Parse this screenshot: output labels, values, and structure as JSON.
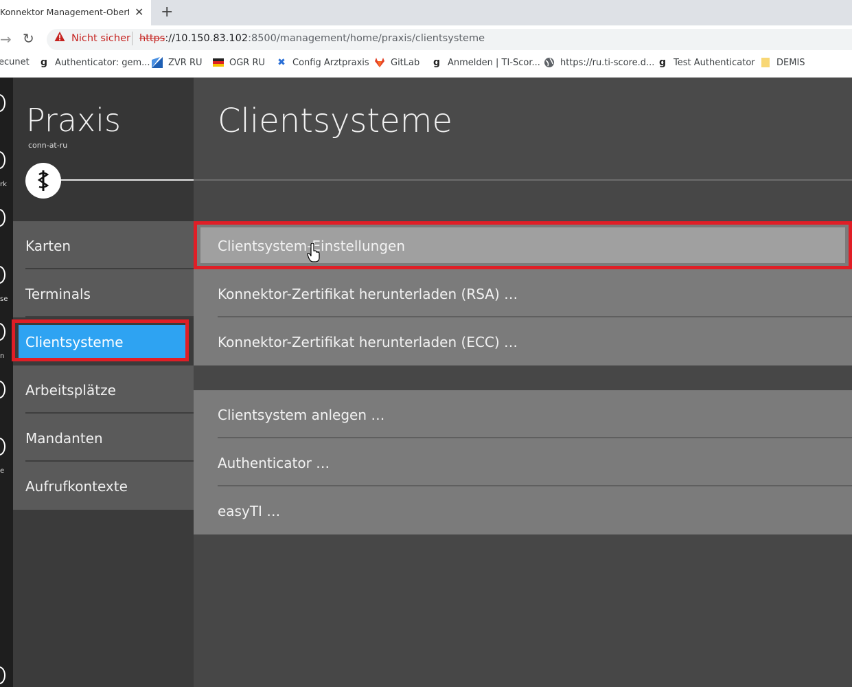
{
  "browser": {
    "tab_title": "Konnektor Management-Oberfläche",
    "tab_close": "✕",
    "new_tab": "+",
    "security_label": "Nicht sicher",
    "url_scheme": "https",
    "url_host": "://10.150.83.102",
    "url_path": ":8500/management/home/praxis/clientsysteme",
    "bookmarks": [
      {
        "label": "ecunet",
        "icon": "none"
      },
      {
        "label": "Authenticator: gem...",
        "icon": "g-icon"
      },
      {
        "label": "ZVR RU",
        "icon": "zvr-icon"
      },
      {
        "label": "OGR RU",
        "icon": "flag-icon"
      },
      {
        "label": "Config Arztpraxis",
        "icon": "x-icon"
      },
      {
        "label": "GitLab",
        "icon": "gitlab-icon"
      },
      {
        "label": "Anmelden | TI-Scor...",
        "icon": "g-icon"
      },
      {
        "label": "https://ru.ti-score.d...",
        "icon": "globe-icon"
      },
      {
        "label": "Test Authenticator",
        "icon": "g-icon"
      },
      {
        "label": "DEMIS",
        "icon": "folder-icon"
      }
    ]
  },
  "left_strip": {
    "fragments": [
      "",
      "rk",
      "",
      "se",
      "n",
      "",
      "e"
    ]
  },
  "sidebar": {
    "title": "Praxis",
    "subtitle": "conn-at-ru",
    "items": [
      {
        "label": "Karten"
      },
      {
        "label": "Terminals"
      },
      {
        "label": "Clientsysteme"
      },
      {
        "label": "Arbeitsplätze"
      },
      {
        "label": "Mandanten"
      },
      {
        "label": "Aufrufkontexte"
      }
    ],
    "active_index": 2
  },
  "main": {
    "title": "Clientsysteme",
    "group1": [
      {
        "label": "Clientsystem-Einstellungen"
      },
      {
        "label": "Konnektor-Zertifikat herunterladen (RSA) …"
      },
      {
        "label": "Konnektor-Zertifikat herunterladen (ECC) …"
      }
    ],
    "group2": [
      {
        "label": "Clientsystem anlegen …"
      },
      {
        "label": "Authenticator …"
      },
      {
        "label": "easyTI …"
      }
    ],
    "selected_item": "Clientsystem-Einstellungen"
  },
  "colors": {
    "highlight_red": "#e01e26",
    "active_blue": "#2ea3f2"
  }
}
